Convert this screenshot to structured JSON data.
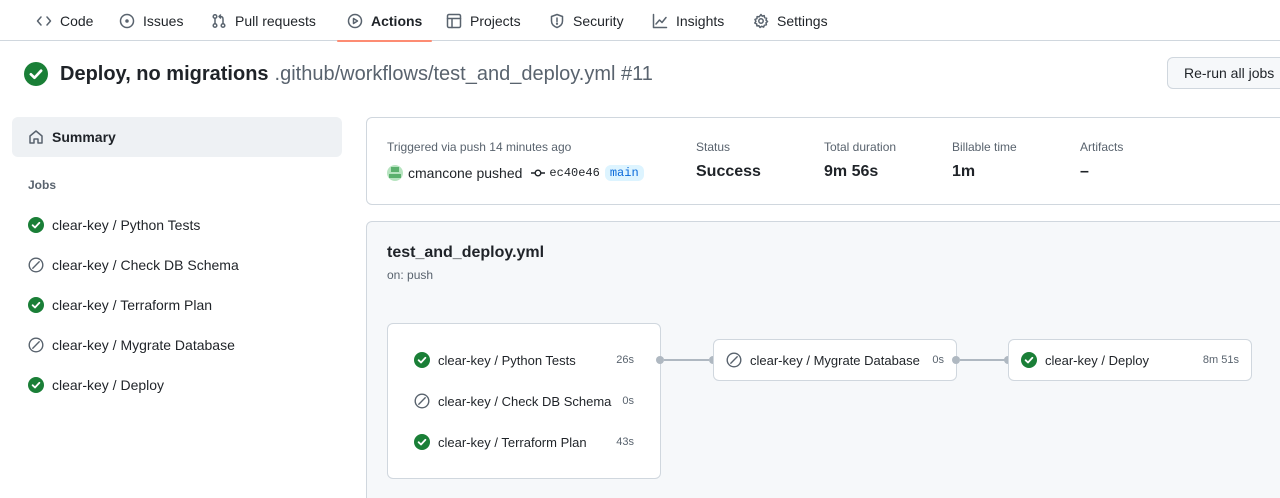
{
  "nav": {
    "items": [
      {
        "label": "Code",
        "icon": "code-icon"
      },
      {
        "label": "Issues",
        "icon": "issue-icon"
      },
      {
        "label": "Pull requests",
        "icon": "pull-request-icon"
      },
      {
        "label": "Actions",
        "icon": "play-icon",
        "active": true
      },
      {
        "label": "Projects",
        "icon": "table-icon"
      },
      {
        "label": "Security",
        "icon": "shield-icon"
      },
      {
        "label": "Insights",
        "icon": "graph-icon"
      },
      {
        "label": "Settings",
        "icon": "gear-icon"
      }
    ]
  },
  "run": {
    "title": "Deploy, no migrations",
    "path": ".github/workflows/test_and_deploy.yml #11",
    "rerun_label": "Re-run all jobs"
  },
  "sidebar": {
    "summary_label": "Summary",
    "jobs_heading": "Jobs",
    "jobs": [
      {
        "label": "clear-key / Python Tests",
        "status": "success"
      },
      {
        "label": "clear-key / Check DB Schema",
        "status": "skipped"
      },
      {
        "label": "clear-key / Terraform Plan",
        "status": "success"
      },
      {
        "label": "clear-key / Mygrate Database",
        "status": "skipped"
      },
      {
        "label": "clear-key / Deploy",
        "status": "success"
      }
    ]
  },
  "summary": {
    "trigger_text": "Triggered via push 14 minutes ago",
    "actor": "cmancone pushed",
    "commit": "ec40e46",
    "branch": "main",
    "status_label": "Status",
    "status_value": "Success",
    "duration_label": "Total duration",
    "duration_value": "9m 56s",
    "billable_label": "Billable time",
    "billable_value": "1m",
    "artifacts_label": "Artifacts",
    "artifacts_value": "–"
  },
  "graph": {
    "file": "test_and_deploy.yml",
    "trigger": "on: push",
    "stage1": [
      {
        "label": "clear-key / Python Tests",
        "duration": "26s",
        "status": "success"
      },
      {
        "label": "clear-key / Check DB Schema",
        "duration": "0s",
        "status": "skipped"
      },
      {
        "label": "clear-key / Terraform Plan",
        "duration": "43s",
        "status": "success"
      }
    ],
    "stage2": {
      "label": "clear-key / Mygrate Database",
      "duration": "0s",
      "status": "skipped"
    },
    "stage3": {
      "label": "clear-key / Deploy",
      "duration": "8m 51s",
      "status": "success"
    }
  },
  "colors": {
    "success": "#1a7f37",
    "skipped": "#59636e",
    "active_underline": "#fd8c73",
    "branch_text": "#0969da"
  }
}
